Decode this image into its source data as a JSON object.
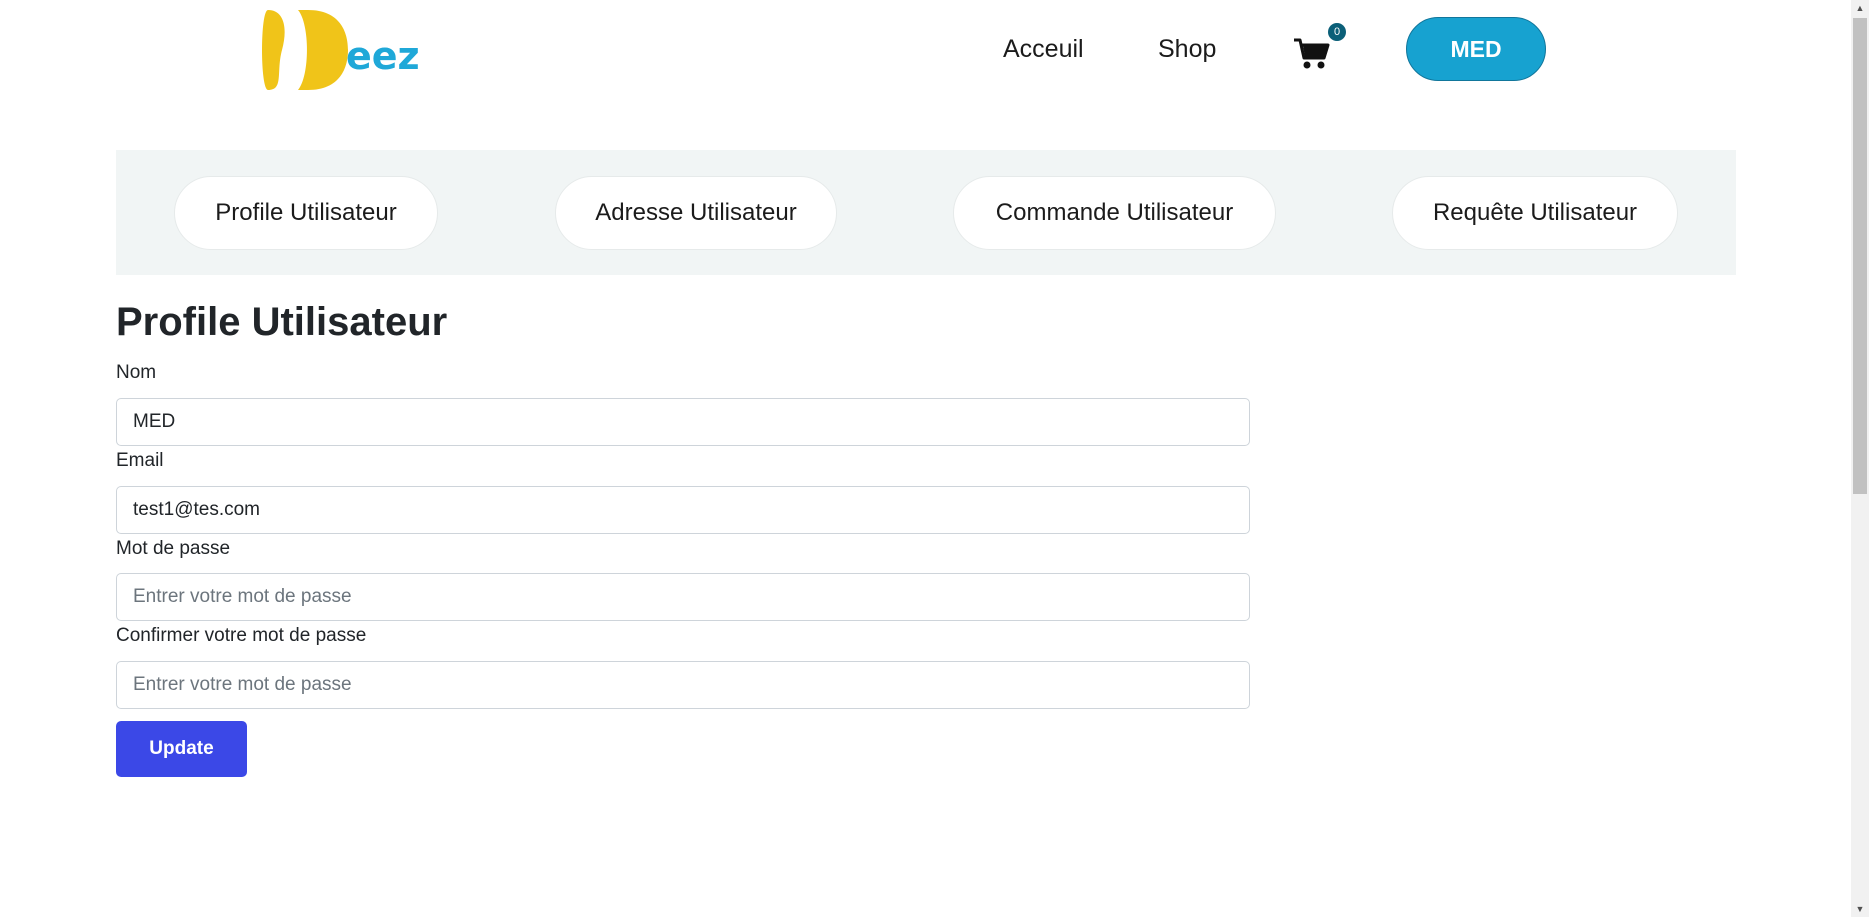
{
  "header": {
    "logo_text": "eez",
    "nav": {
      "home_label": "Acceuil",
      "shop_label": "Shop"
    },
    "cart": {
      "icon": "cart-icon",
      "count": "0"
    },
    "user_button_label": "MED"
  },
  "tabs": [
    {
      "label": "Profile Utilisateur"
    },
    {
      "label": "Adresse Utilisateur"
    },
    {
      "label": "Commande Utilisateur"
    },
    {
      "label": "Requête Utilisateur"
    }
  ],
  "form": {
    "title": "Profile Utilisateur",
    "name": {
      "label": "Nom",
      "value": "MED"
    },
    "email": {
      "label": "Email",
      "value": "test1@tes.com"
    },
    "password": {
      "label": "Mot de passe",
      "placeholder": "Entrer votre mot de passe"
    },
    "confirm_password": {
      "label": "Confirmer votre mot de passe",
      "placeholder": "Entrer votre mot de passe"
    },
    "submit_label": "Update"
  },
  "colors": {
    "logo_yellow": "#f0c419",
    "logo_blue": "#1fa8d8",
    "user_button": "#17a2d0",
    "cart_badge": "#0b5f78",
    "tabs_background": "#f1f5f5",
    "update_button": "#3b48e7"
  }
}
